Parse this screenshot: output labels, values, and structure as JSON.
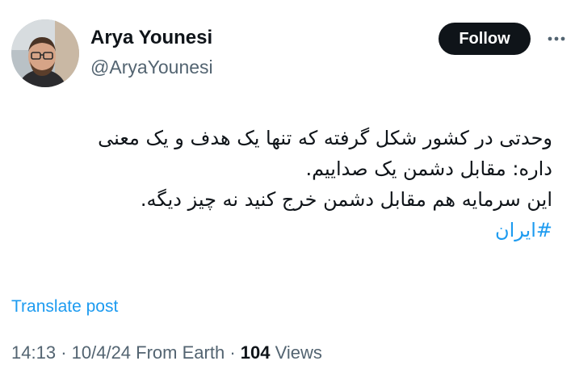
{
  "author": {
    "display_name": "Arya Younesi",
    "handle": "@AryaYounesi"
  },
  "header": {
    "follow_label": "Follow",
    "more_icon": "more-horizontal-icon"
  },
  "tweet": {
    "lines": [
      "وحدتی در کشور شکل گرفته که تنها یک هدف و یک معنی",
      "داره: مقابل دشمن یک صداییم.",
      "این سرمایه هم مقابل دشمن خرج کنید نه چیز دیگه."
    ],
    "hashtag": "#ایران"
  },
  "translate_label": "Translate post",
  "meta": {
    "time": "14:13",
    "separator": "·",
    "date": "10/4/24",
    "source": "From Earth",
    "views_count": "104",
    "views_label": "Views"
  },
  "colors": {
    "link": "#1d9bf0",
    "text": "#0f1419",
    "muted": "#536471",
    "button_bg": "#0f1419"
  }
}
